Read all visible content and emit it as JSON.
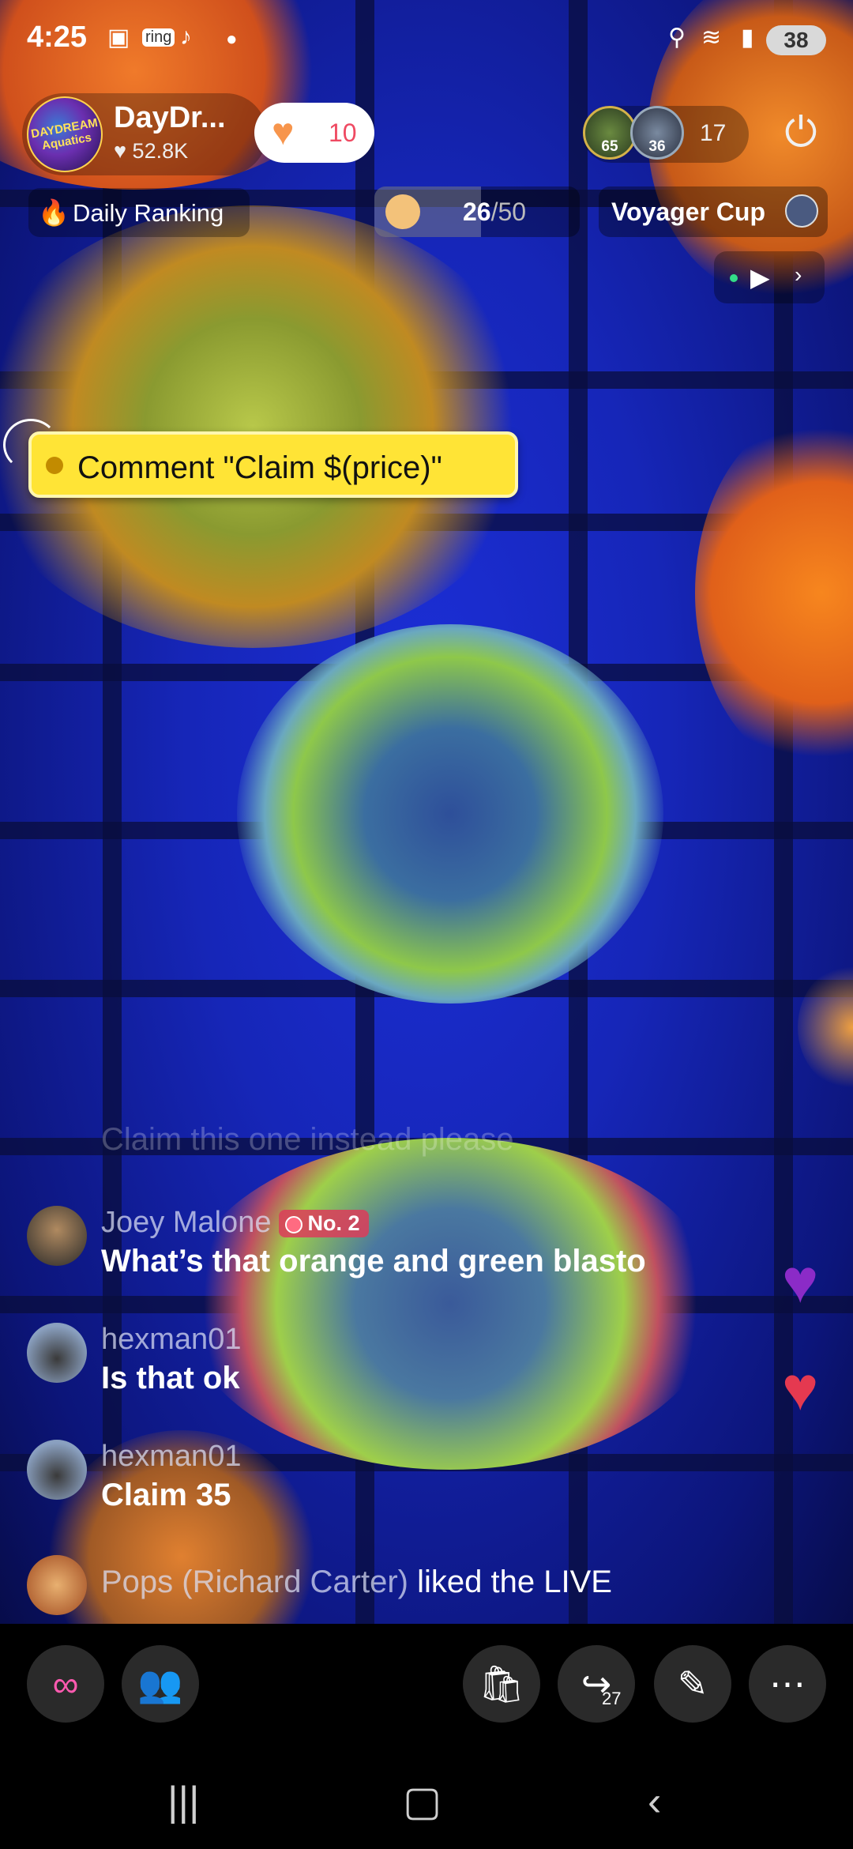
{
  "status_bar": {
    "time": "4:25",
    "battery": "38",
    "icons": [
      "screenshot-icon",
      "ring-app-icon",
      "tiktok-icon",
      "dot",
      "location-icon",
      "wifi-icon",
      "signal-icon"
    ]
  },
  "host": {
    "name": "DayDr...",
    "likes": "52.8K",
    "avatar_text": "DAYDREAM Aquatics"
  },
  "like_pill": {
    "count": "10"
  },
  "viewers": {
    "avatars": [
      {
        "label": "65"
      },
      {
        "label": "36"
      }
    ],
    "count": "17"
  },
  "daily_ranking": {
    "label": "Daily Ranking"
  },
  "goal": {
    "current": "26",
    "total": "/50",
    "fraction": 0.52
  },
  "voyager": {
    "label": "Voyager Cup"
  },
  "claim_tag": {
    "text": "Comment \"Claim $(price)\""
  },
  "comments": [
    {
      "user": "Joey Malone",
      "badge": "No. 2",
      "message": "What’s that orange and green blasto"
    },
    {
      "user": "hexman01",
      "message": "Is that ok"
    },
    {
      "user": "hexman01",
      "message": "Claim 35"
    }
  ],
  "faded_comment": "Claim this one instead please",
  "activity": {
    "user": "Pops (Richard Carter)",
    "action": "liked the LIVE"
  },
  "bottom_bar": {
    "share_count": "27",
    "buttons": [
      "collab-icon",
      "group-icon",
      "shopping-bag-icon",
      "share-icon",
      "magic-wand-icon",
      "more-icon"
    ]
  },
  "colors": {
    "like_accent": "#f7954c",
    "heart_red": "#e53950",
    "heart_purple": "#8b2bc7",
    "tag_yellow": "#ffe436"
  }
}
